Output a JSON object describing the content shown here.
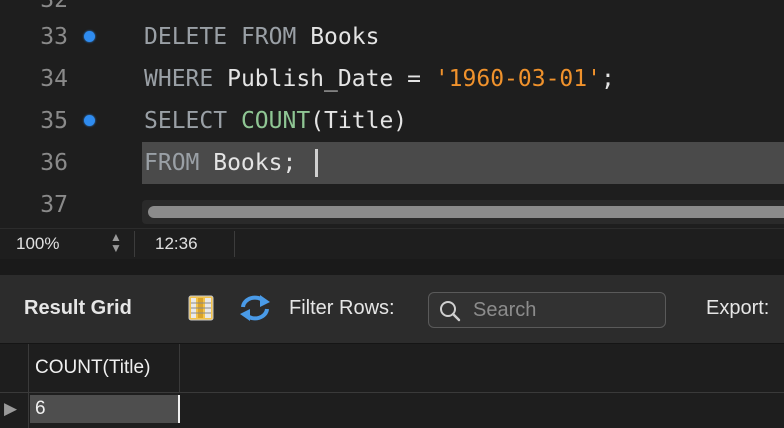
{
  "editor": {
    "partial_line_number": "32",
    "lines": [
      {
        "num": "33",
        "marked": true,
        "kw1": "DELETE",
        "kw2": "FROM",
        "rest": " Books"
      },
      {
        "num": "34",
        "marked": false,
        "kw": "WHERE",
        "mid": " Publish_Date = ",
        "str": "'1960-03-01'",
        "end": ";"
      },
      {
        "num": "35",
        "marked": true,
        "kw": "SELECT",
        "fn": "COUNT",
        "rest": "(Title)"
      },
      {
        "num": "36",
        "marked": false,
        "kw": "FROM",
        "rest": " Books;"
      },
      {
        "num": "37"
      }
    ]
  },
  "status_bar": {
    "zoom": "100%",
    "cursor_position": "12:36"
  },
  "result_toolbar": {
    "title": "Result Grid",
    "grid_toggle_icon": "result-grid-icon",
    "refresh_icon": "refresh-icon",
    "filter_label": "Filter Rows:",
    "search_placeholder": "Search",
    "search_value": "",
    "export_label": "Export:"
  },
  "result_grid": {
    "columns": [
      "COUNT(Title)"
    ],
    "rows": [
      [
        "6"
      ]
    ]
  },
  "colors": {
    "keyword": "#9aa0a6",
    "function": "#8fc694",
    "string": "#f0922c",
    "marker": "#2f8cf0"
  }
}
